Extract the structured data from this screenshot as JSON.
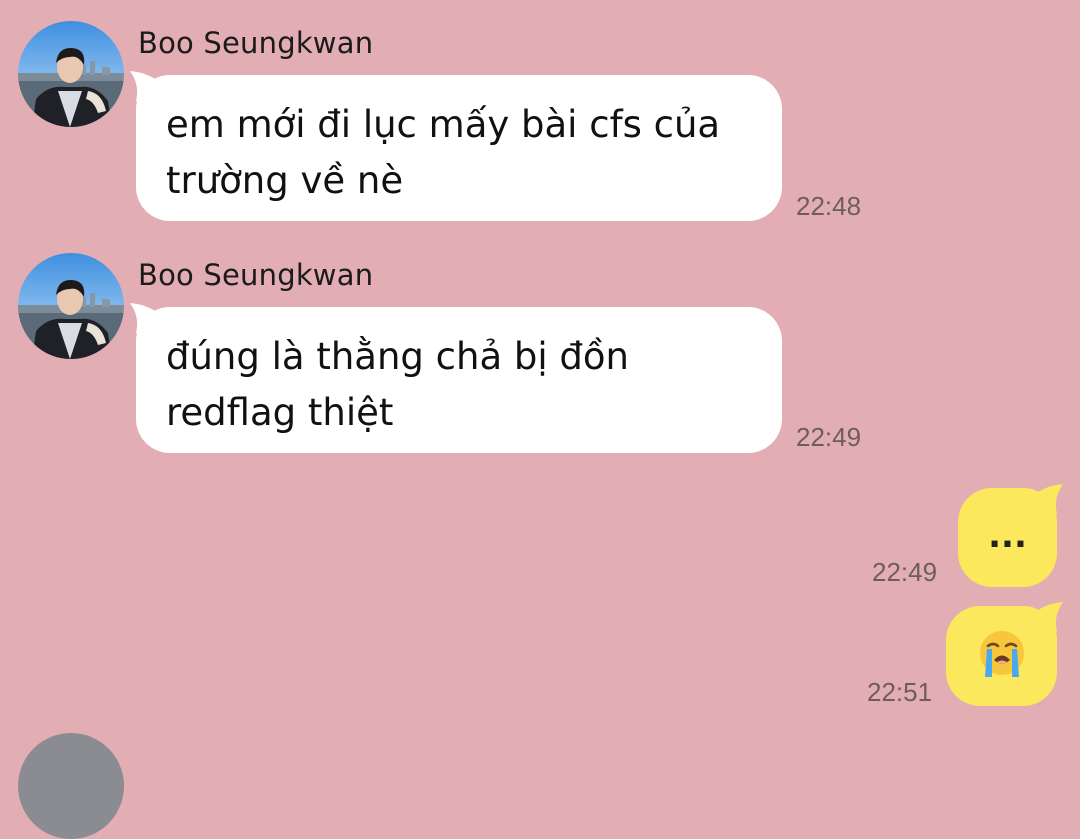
{
  "messages": [
    {
      "sender": "Boo Seungkwan",
      "text": "em mới đi lục mấy bài cfs của\ntrường về nè",
      "time": "22:48"
    },
    {
      "sender": "Boo Seungkwan",
      "text": "đúng là thằng chả bị đồn\nredflag thiệt",
      "time": "22:49"
    }
  ],
  "sent": [
    {
      "text": "...",
      "time": "22:49"
    },
    {
      "emoji": "loudly-crying-face",
      "time": "22:51"
    }
  ],
  "colors": {
    "background": "#e3aeb3",
    "incoming_bubble": "#ffffff",
    "outgoing_bubble": "#fbe85c",
    "timestamp": "#6e5c60"
  },
  "icons": {
    "avatar": "profile-photo",
    "emoji": "loudly-crying-face"
  }
}
